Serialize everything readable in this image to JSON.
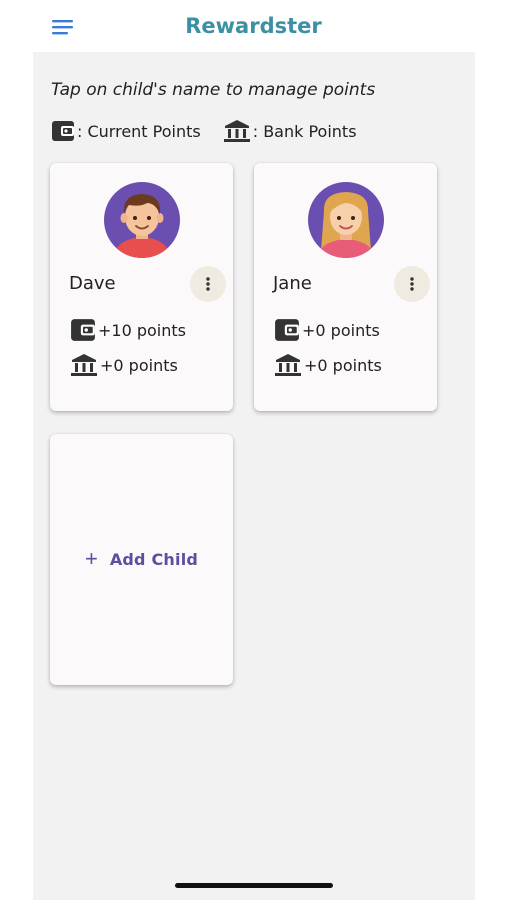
{
  "app": {
    "title": "Rewardster"
  },
  "header": {
    "menu_icon": "hamburger-menu-icon"
  },
  "instruction": "Tap on child's name to manage points",
  "legend": {
    "current": {
      "icon": "wallet-icon",
      "label": ": Current Points"
    },
    "bank": {
      "icon": "bank-icon",
      "label": ": Bank Points"
    }
  },
  "children": [
    {
      "name": "Dave",
      "avatar": "boy-avatar-icon",
      "current_points": "+10 points",
      "bank_points": "+0 points"
    },
    {
      "name": "Jane",
      "avatar": "girl-avatar-icon",
      "current_points": "+0 points",
      "bank_points": "+0 points"
    }
  ],
  "add_child": {
    "icon": "plus-icon",
    "label": "Add Child"
  },
  "colors": {
    "title": "#3d8fa3",
    "accent": "#5d4fa0",
    "avatar_bg": "#6a4fb0",
    "menu_icon": "#3a7bd5",
    "background": "#f2f2f2",
    "card": "#fbf9fa"
  }
}
